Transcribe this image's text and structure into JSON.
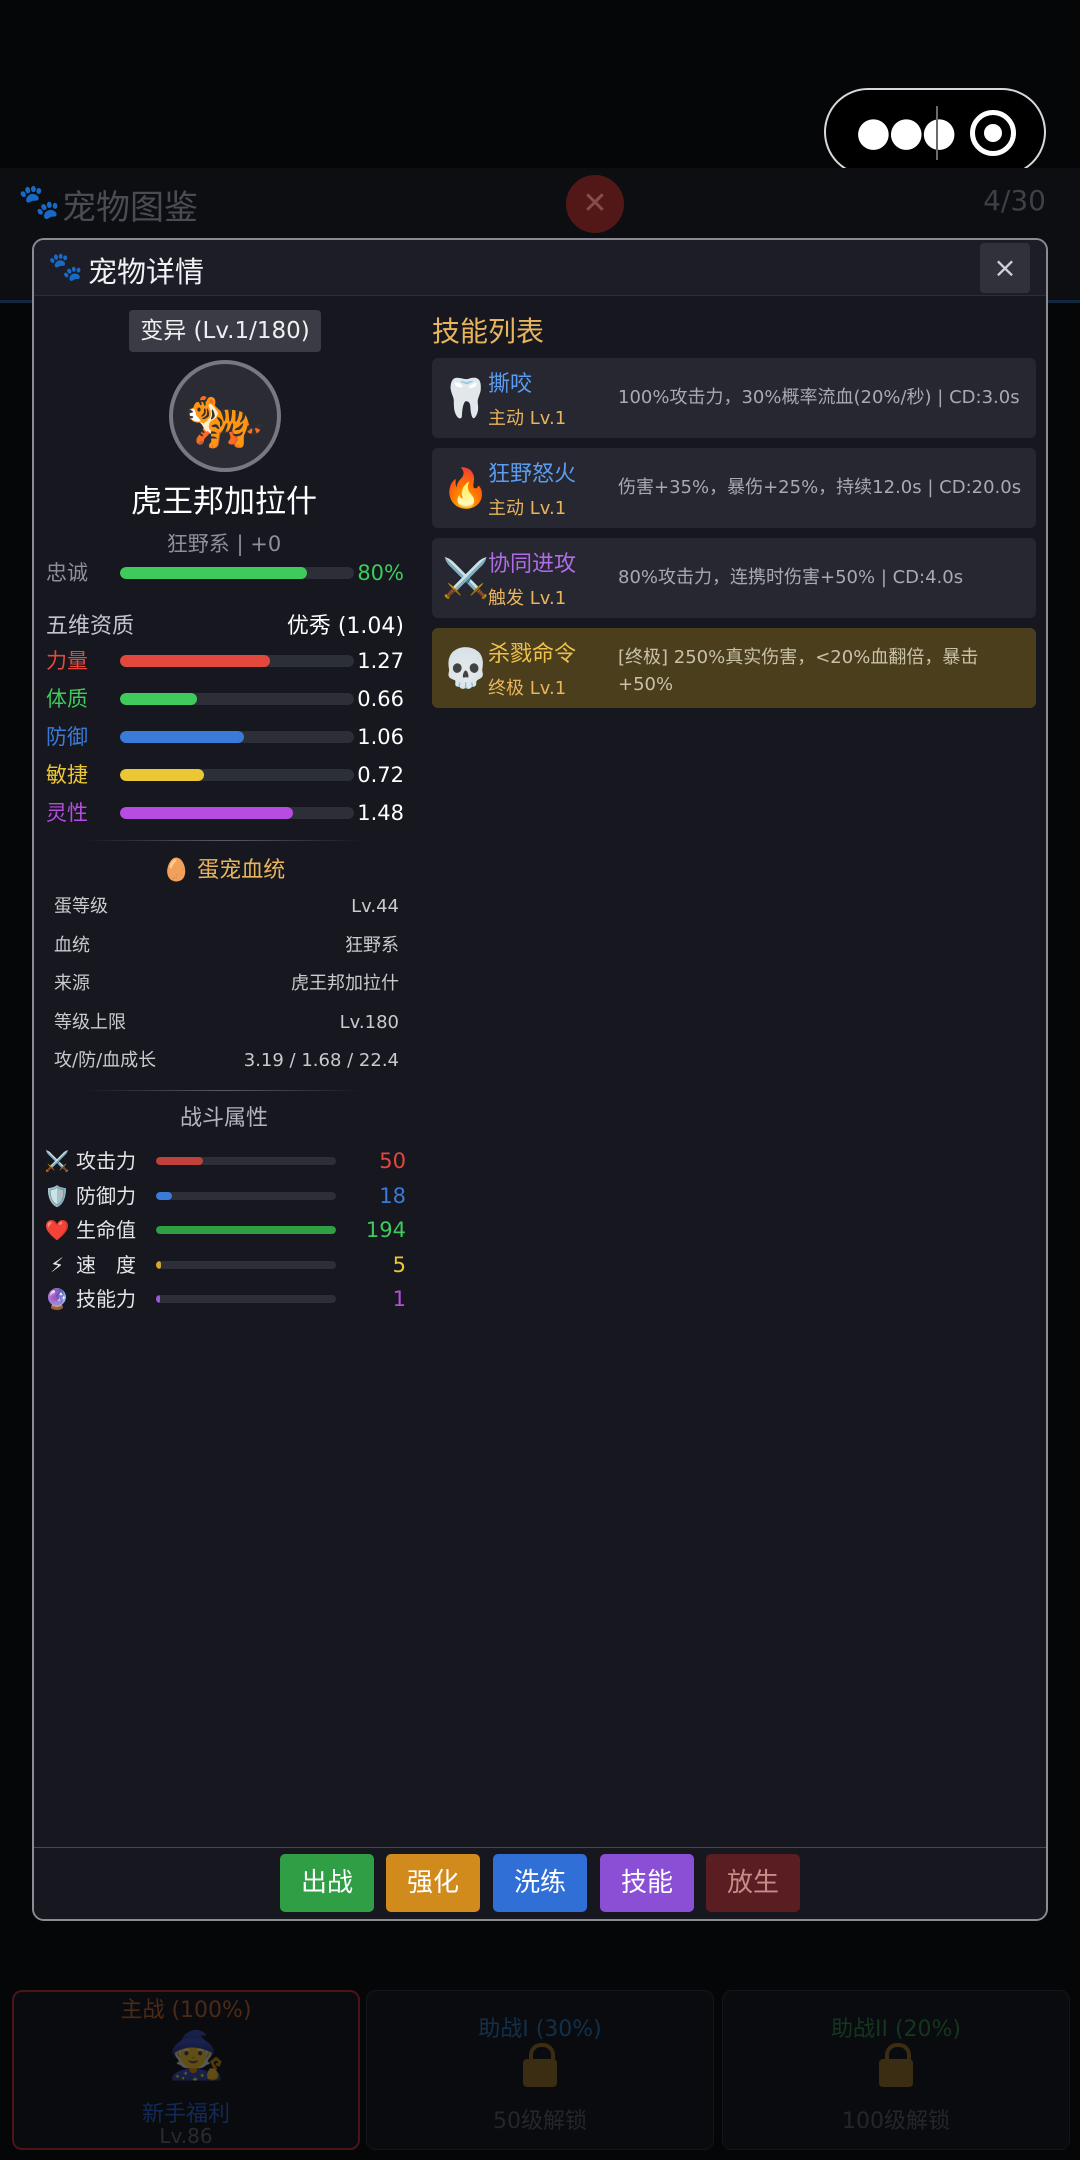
{
  "colors": {
    "accent_gold": "#e8b55c",
    "loyalty": "#3ecb5c",
    "str": "#e2483c",
    "con": "#3ecb5c",
    "def": "#3a7ad8",
    "agi": "#ecc735",
    "spi": "#b64ce0",
    "attack": "#c0403a",
    "defense": "#3a7ad8",
    "hp": "#2ea043",
    "speed": "#d4a72c",
    "skill": "#9b59d6"
  },
  "background": {
    "title": "宠物图鉴",
    "count": "4/30",
    "slots": [
      {
        "title": "主战 (100%)",
        "name": "新手福利",
        "level": "Lv.86"
      },
      {
        "title": "助战I (30%)",
        "lock_text": "50级解锁"
      },
      {
        "title": "助战II (20%)",
        "lock_text": "100级解锁"
      }
    ]
  },
  "modal": {
    "title": "宠物详情",
    "close_label": "×",
    "pet": {
      "mutation_badge": "变异 (Lv.1/180)",
      "avatar_icon": "tiger-icon",
      "name": "虎王邦加拉什",
      "subtitle": "狂野系 | +0",
      "loyalty": {
        "label": "忠诚",
        "value": "80%",
        "fill": 0.8
      }
    },
    "aptitude": {
      "label": "五维资质",
      "grade": "优秀 (1.04)",
      "stats": [
        {
          "label": "力量",
          "value": "1.27",
          "fill": 0.64
        },
        {
          "label": "体质",
          "value": "0.66",
          "fill": 0.33
        },
        {
          "label": "防御",
          "value": "1.06",
          "fill": 0.53
        },
        {
          "label": "敏捷",
          "value": "0.72",
          "fill": 0.36
        },
        {
          "label": "灵性",
          "value": "1.48",
          "fill": 0.74
        }
      ]
    },
    "bloodline": {
      "title": "蛋宠血统",
      "rows": [
        {
          "k": "蛋等级",
          "v": "Lv.44"
        },
        {
          "k": "血统",
          "v": "狂野系"
        },
        {
          "k": "来源",
          "v": "虎王邦加拉什"
        },
        {
          "k": "等级上限",
          "v": "Lv.180"
        },
        {
          "k": "攻/防/血成长",
          "v": "3.19 / 1.68 / 22.4"
        }
      ]
    },
    "battle": {
      "title": "战斗属性",
      "stats": [
        {
          "icon": "crossed-swords-icon",
          "label": "攻击力",
          "value": "50",
          "fill": 0.26
        },
        {
          "icon": "shield-icon",
          "label": "防御力",
          "value": "18",
          "fill": 0.09
        },
        {
          "icon": "heart-icon",
          "label": "生命值",
          "value": "194",
          "fill": 1.0
        },
        {
          "icon": "lightning-icon",
          "label": "速　度",
          "value": "5",
          "fill": 0.03
        },
        {
          "icon": "crystal-ball-icon",
          "label": "技能力",
          "value": "1",
          "fill": 0.01
        }
      ]
    },
    "skills": {
      "title": "技能列表",
      "items": [
        {
          "icon": "tooth-icon",
          "name": "撕咬",
          "level": "主动 Lv.1",
          "desc": "100%攻击力，30%概率流血(20%/秒) | CD:3.0s",
          "name_color": "#5b9cf0"
        },
        {
          "icon": "fire-icon",
          "name": "狂野怒火",
          "level": "主动 Lv.1",
          "desc": "伤害+35%，暴伤+25%，持续12.0s | CD:20.0s",
          "name_color": "#5b9cf0"
        },
        {
          "icon": "crossed-swords-icon",
          "name": "协同进攻",
          "level": "触发 Lv.1",
          "desc": "80%攻击力，连携时伤害+50% | CD:4.0s",
          "name_color": "#b06be8"
        },
        {
          "icon": "skull-icon",
          "name": "杀戮命令",
          "level": "终极 Lv.1",
          "desc": "[终极] 250%真实伤害，<20%血翻倍，暴击+50%",
          "name_color": "#f0c24c"
        }
      ]
    },
    "actions": [
      {
        "label": "出战",
        "color": "#2f9e44"
      },
      {
        "label": "强化",
        "color": "#d18b1c"
      },
      {
        "label": "洗练",
        "color": "#2f6fd6"
      },
      {
        "label": "技能",
        "color": "#8b4fd6"
      },
      {
        "label": "放生",
        "color": "#5a1e22",
        "text_color": "#c98a8a"
      }
    ]
  }
}
